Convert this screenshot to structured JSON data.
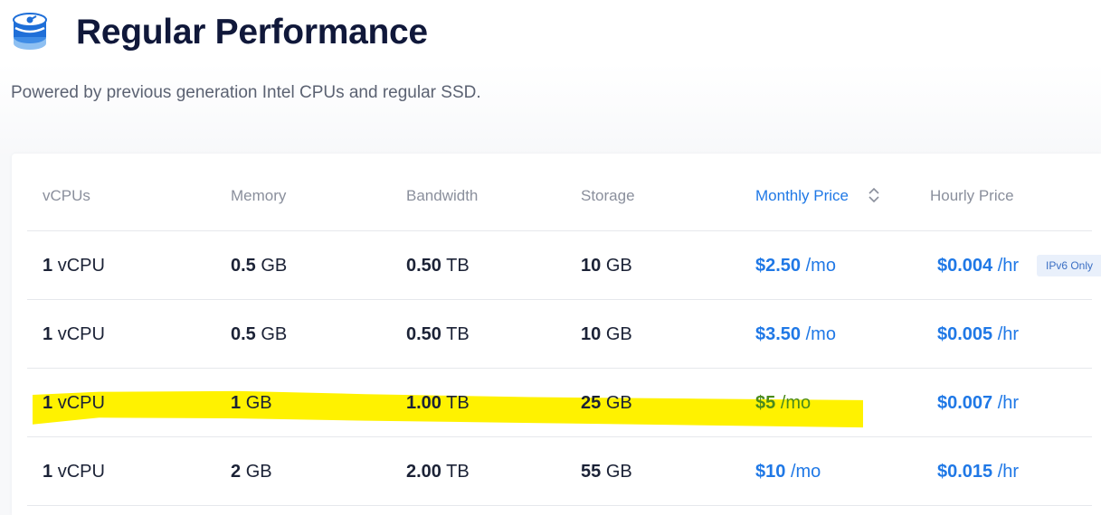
{
  "header": {
    "title": "Regular Performance",
    "subtitle": "Powered by previous generation Intel CPUs and regular SSD."
  },
  "table": {
    "columns": [
      "vCPUs",
      "Memory",
      "Bandwidth",
      "Storage",
      "Monthly Price",
      "Hourly Price"
    ],
    "sorted_column": "Monthly Price",
    "rows": [
      {
        "vcpu_num": "1",
        "vcpu_unit": "vCPU",
        "mem_num": "0.5",
        "mem_unit": "GB",
        "bw_num": "0.50",
        "bw_unit": "TB",
        "storage_num": "10",
        "storage_unit": "GB",
        "monthly_num": "$2.50",
        "monthly_unit": "/mo",
        "hourly_num": "$0.004",
        "hourly_unit": "/hr",
        "badge": "IPv6 Only"
      },
      {
        "vcpu_num": "1",
        "vcpu_unit": "vCPU",
        "mem_num": "0.5",
        "mem_unit": "GB",
        "bw_num": "0.50",
        "bw_unit": "TB",
        "storage_num": "10",
        "storage_unit": "GB",
        "monthly_num": "$3.50",
        "monthly_unit": "/mo",
        "hourly_num": "$0.005",
        "hourly_unit": "/hr"
      },
      {
        "vcpu_num": "1",
        "vcpu_unit": "vCPU",
        "mem_num": "1",
        "mem_unit": "GB",
        "bw_num": "1.00",
        "bw_unit": "TB",
        "storage_num": "25",
        "storage_unit": "GB",
        "monthly_num": "$5",
        "monthly_unit": "/mo",
        "hourly_num": "$0.007",
        "hourly_unit": "/hr",
        "highlighted": true
      },
      {
        "vcpu_num": "1",
        "vcpu_unit": "vCPU",
        "mem_num": "2",
        "mem_unit": "GB",
        "bw_num": "2.00",
        "bw_unit": "TB",
        "storage_num": "55",
        "storage_unit": "GB",
        "monthly_num": "$10",
        "monthly_unit": "/mo",
        "hourly_num": "$0.015",
        "hourly_unit": "/hr"
      }
    ]
  },
  "colors": {
    "accent": "#1f78e6",
    "title": "#10183a",
    "highlight": "#fff200",
    "highlighted_price": "#4a8a1c"
  },
  "icons": {
    "logo": "server-disk-icon",
    "sort": "sort-chevrons-icon"
  }
}
